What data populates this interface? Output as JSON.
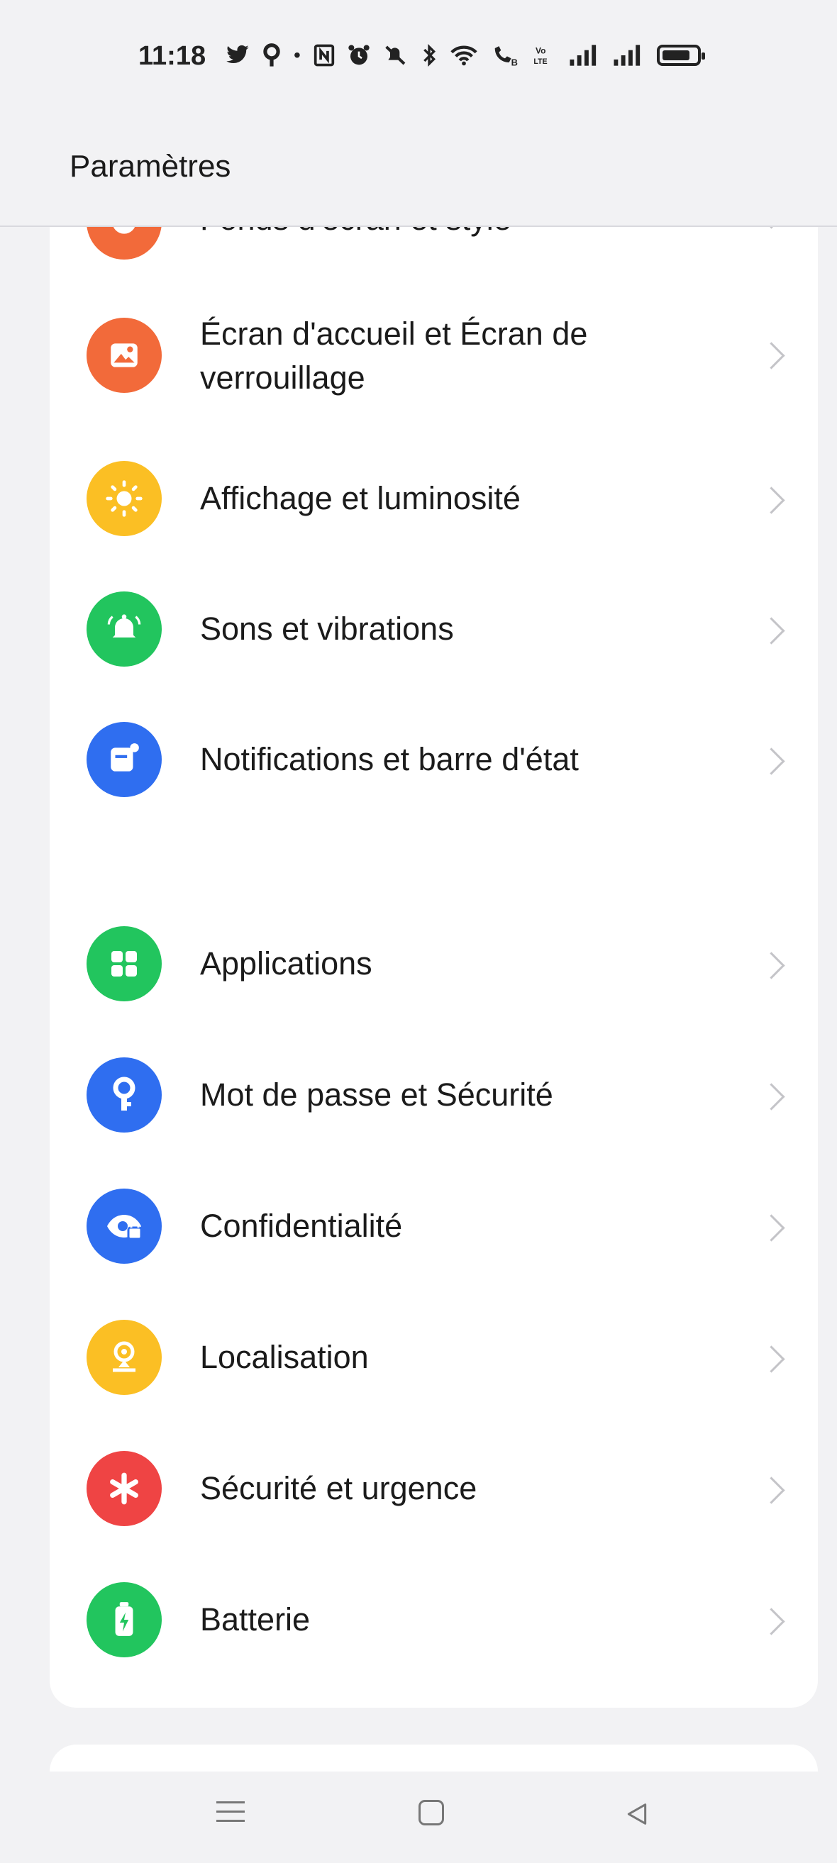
{
  "status_bar": {
    "time": "11:18",
    "icons": [
      "twitter-icon",
      "map-pin-icon",
      "dot-icon",
      "nfc-icon",
      "alarm-icon",
      "mute-icon",
      "bluetooth-icon",
      "wifi-icon",
      "wifi-calling-icon",
      "volte-icon",
      "signal-icon",
      "signal-icon",
      "battery-icon"
    ],
    "glyphs": {
      "twitter": "🐦",
      "pin": "⚲",
      "dot": "•",
      "nfc": "N",
      "alarm": "⏰",
      "mute": "🔕",
      "bt": "ᛒ",
      "wifi": "≋",
      "wificall": "☏",
      "volte": "VoLTE",
      "sig1": "▂▄▆",
      "sig2": "▂▄▆"
    }
  },
  "header": {
    "title": "Paramètres"
  },
  "sections": [
    {
      "items": [
        {
          "label": "Fonds d'écran et style",
          "icon": "palette-icon",
          "color": "#f26a3a"
        },
        {
          "label": "Écran d'accueil et Écran de verrouillage",
          "label_line1": "Écran d'accueil et Écran de",
          "label_line2": "verrouillage",
          "icon": "image-icon",
          "color": "#f26a3a"
        },
        {
          "label": "Affichage et luminosité",
          "icon": "sun-icon",
          "color": "#fbbf24"
        },
        {
          "label": "Sons et vibrations",
          "icon": "bell-icon",
          "color": "#22c55e"
        },
        {
          "label": "Notifications et barre d'état",
          "icon": "notification-icon",
          "color": "#2f6ef0"
        }
      ]
    },
    {
      "items": [
        {
          "label": "Applications",
          "icon": "apps-grid-icon",
          "color": "#22c55e"
        },
        {
          "label": "Mot de passe et Sécurité",
          "icon": "key-icon",
          "color": "#2f6ef0"
        },
        {
          "label": "Confidentialité",
          "icon": "privacy-eye-icon",
          "color": "#2f6ef0"
        },
        {
          "label": "Localisation",
          "icon": "location-icon",
          "color": "#fbbf24"
        },
        {
          "label": "Sécurité et urgence",
          "icon": "emergency-asterisk-icon",
          "color": "#ef4444"
        },
        {
          "label": "Batterie",
          "icon": "battery-charge-icon",
          "color": "#22c55e"
        }
      ]
    }
  ],
  "nav": {
    "menu": "menu-icon",
    "home": "home-icon",
    "back": "back-icon"
  }
}
